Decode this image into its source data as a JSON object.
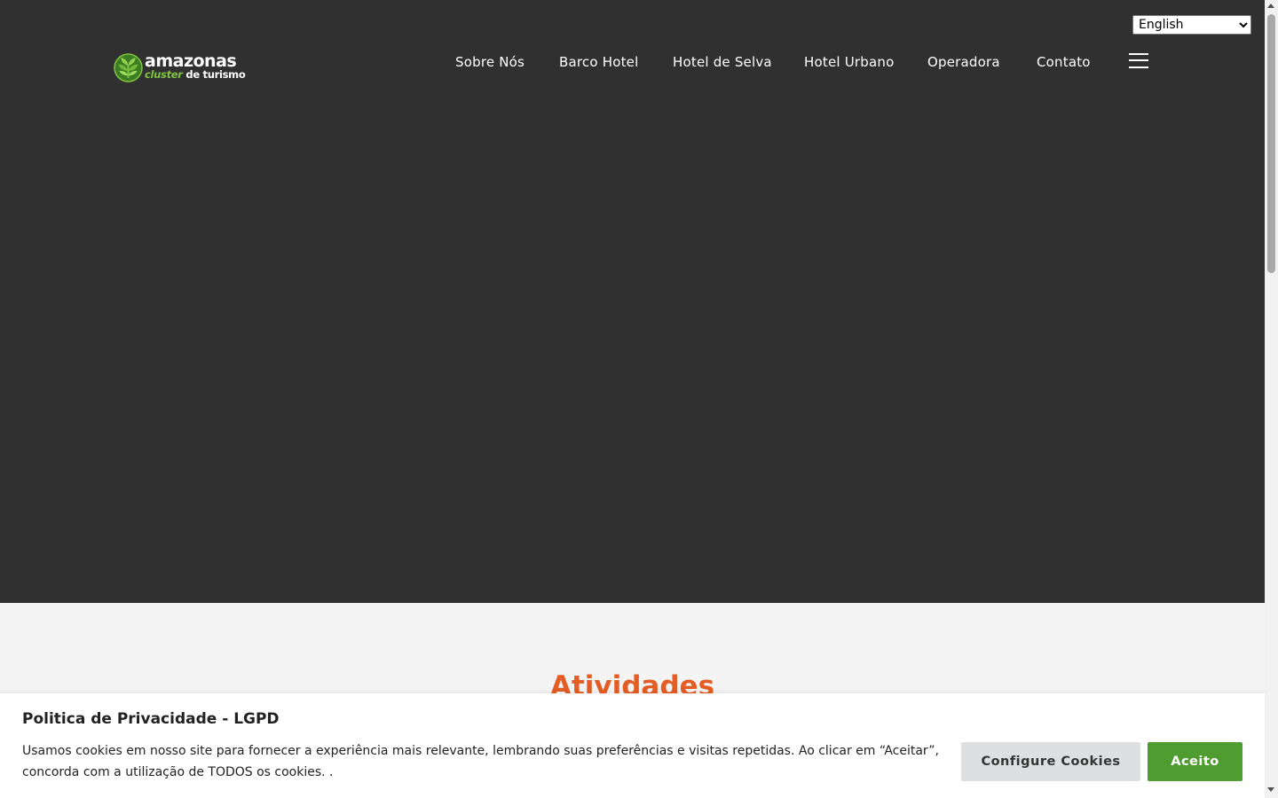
{
  "language_select": {
    "selected": "English",
    "icon": "chevron-down-icon"
  },
  "logo": {
    "word_top": "amazonas",
    "word_bottom_green": "cluster",
    "word_bottom_white": "de turismo",
    "icon": "leaf-globe-icon",
    "colors": {
      "green": "#7fc241",
      "white": "#ffffff"
    }
  },
  "nav": {
    "items": [
      {
        "label": "Sobre Nós"
      },
      {
        "label": "Barco Hotel"
      },
      {
        "label": "Hotel de Selva"
      },
      {
        "label": "Hotel Urbano"
      },
      {
        "label": "Operadora"
      },
      {
        "label": "Contato"
      }
    ],
    "menu_icon": "hamburger-menu-icon"
  },
  "section": {
    "title": "Atividades"
  },
  "cookie_bar": {
    "title": "Politica de Privacidade - LGPD",
    "text": "Usamos cookies em nosso site para fornecer a experiência mais relevante, lembrando suas preferências e visitas repetidas. Ao clicar em “Aceitar”, concorda com a utilização de TODOS os cookies. .",
    "configure_label": "Configure Cookies",
    "accept_label": "Aceito"
  },
  "colors": {
    "hero_background": "#303030",
    "section_background": "#f4f4f4",
    "accent_orange": "#e45d25",
    "accept_green": "#4f9c30",
    "configure_gray": "#dedfe0"
  }
}
